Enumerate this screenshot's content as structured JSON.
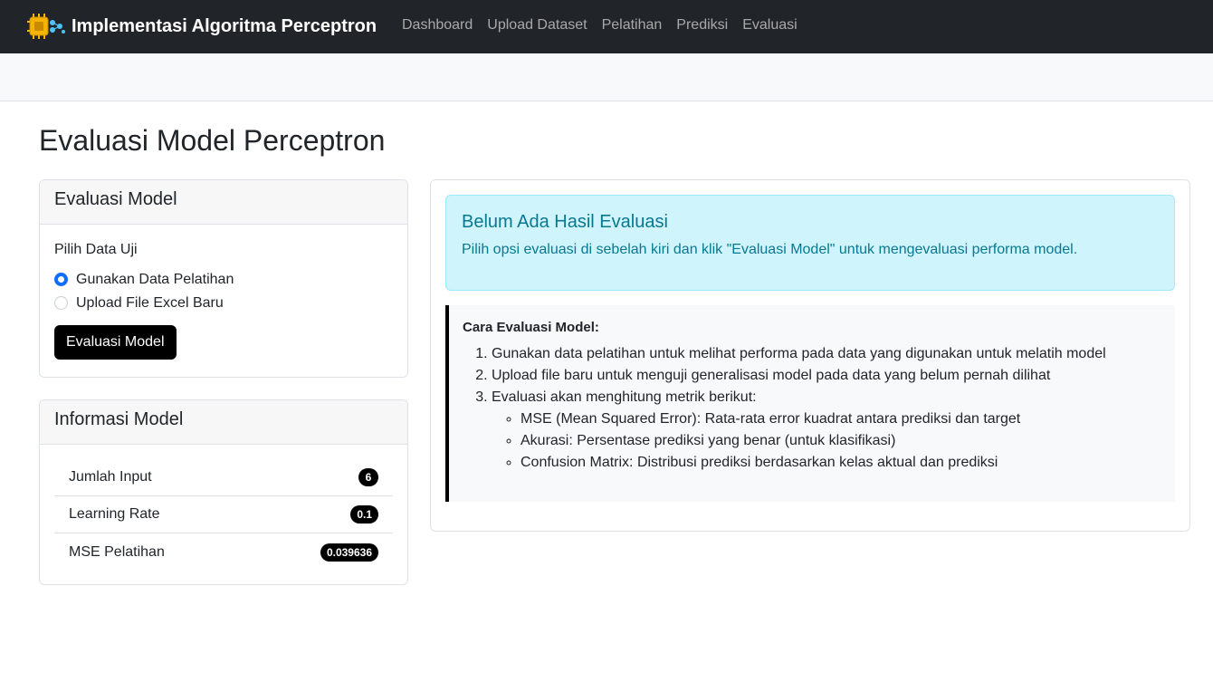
{
  "navbar": {
    "brand": "Implementasi Algoritma Perceptron",
    "brand_icon": "chip-network-icon",
    "links": [
      "Dashboard",
      "Upload Dataset",
      "Pelatihan",
      "Prediksi",
      "Evaluasi"
    ]
  },
  "page": {
    "title": "Evaluasi Model Perceptron"
  },
  "eval_card": {
    "header": "Evaluasi Model",
    "label": "Pilih Data Uji",
    "options": [
      "Gunakan Data Pelatihan",
      "Upload File Excel Baru"
    ],
    "selected_option": "Gunakan Data Pelatihan",
    "button": "Evaluasi Model"
  },
  "info_card": {
    "header": "Informasi Model",
    "rows": [
      {
        "label": "Jumlah Input",
        "value": "6"
      },
      {
        "label": "Learning Rate",
        "value": "0.1"
      },
      {
        "label": "MSE Pelatihan",
        "value": "0.039636"
      }
    ]
  },
  "alert": {
    "title": "Belum Ada Hasil Evaluasi",
    "text": "Pilih opsi evaluasi di sebelah kiri dan klik \"Evaluasi Model\" untuk mengevaluasi performa model."
  },
  "howto": {
    "title": "Cara Evaluasi Model:",
    "steps": [
      "Gunakan data pelatihan untuk melihat performa pada data yang digunakan untuk melatih model",
      "Upload file baru untuk menguji generalisasi model pada data yang belum pernah dilihat",
      "Evaluasi akan menghitung metrik berikut:"
    ],
    "metrics": [
      "MSE (Mean Squared Error): Rata-rata error kuadrat antara prediksi dan target",
      "Akurasi: Persentase prediksi yang benar (untuk klasifikasi)",
      "Confusion Matrix: Distribusi prediksi berdasarkan kelas aktual dan prediksi"
    ]
  },
  "colors": {
    "navbar_bg": "#212529",
    "primary": "#0d6efd",
    "alert_bg": "#cff4fc",
    "alert_text": "#087990"
  }
}
